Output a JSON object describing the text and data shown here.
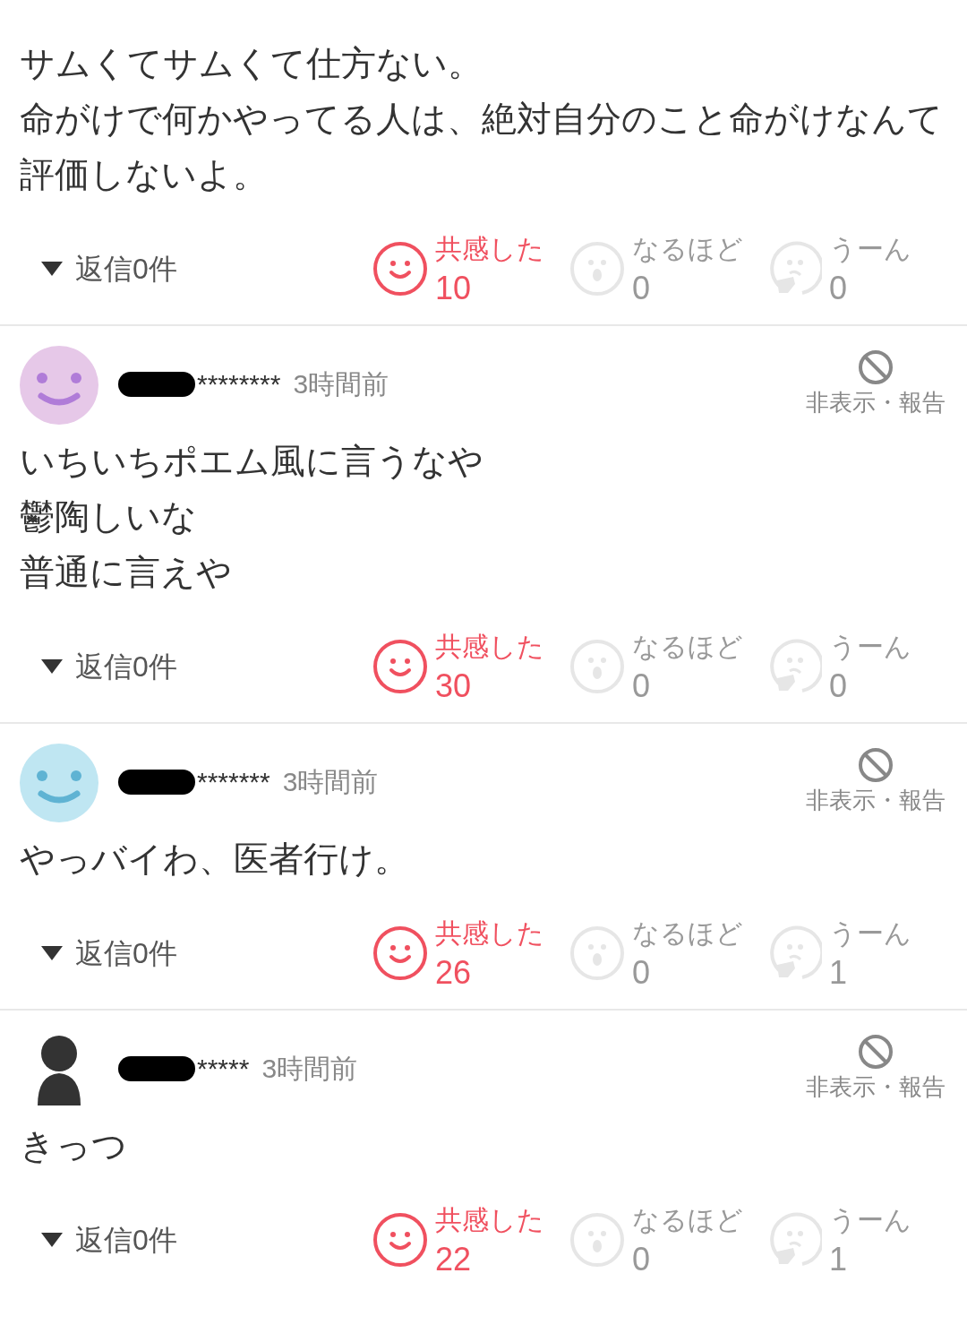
{
  "comments": [
    {
      "body": [
        "サムくてサムくて仕方ない。",
        "命がけで何かやってる人は、絶対自分のこと命がけなんて評価しないよ。"
      ],
      "replies": "返信0件",
      "reactions": [
        {
          "kind": "smile",
          "label": "共感した",
          "count": "10",
          "selected": true
        },
        {
          "kind": "surprise",
          "label": "なるほど",
          "count": "0",
          "selected": false
        },
        {
          "kind": "ponder",
          "label": "うーん",
          "count": "0",
          "selected": false
        }
      ]
    },
    {
      "avatar": {
        "kind": "smiley",
        "color": "#e6c8e8"
      },
      "user": "********",
      "time": "3時間前",
      "hide": "非表示・報告",
      "body": [
        "いちいちポエム風に言うなや",
        "鬱陶しいな",
        "普通に言えや"
      ],
      "replies": "返信0件",
      "reactions": [
        {
          "kind": "smile",
          "label": "共感した",
          "count": "30",
          "selected": true
        },
        {
          "kind": "surprise",
          "label": "なるほど",
          "count": "0",
          "selected": false
        },
        {
          "kind": "ponder",
          "label": "うーん",
          "count": "0",
          "selected": false
        }
      ]
    },
    {
      "avatar": {
        "kind": "smiley",
        "color": "#bfe6f2"
      },
      "user": "*******",
      "time": "3時間前",
      "hide": "非表示・報告",
      "body": [
        "やっバイわ、医者行け。"
      ],
      "replies": "返信0件",
      "reactions": [
        {
          "kind": "smile",
          "label": "共感した",
          "count": "26",
          "selected": true
        },
        {
          "kind": "surprise",
          "label": "なるほど",
          "count": "0",
          "selected": false
        },
        {
          "kind": "ponder",
          "label": "うーん",
          "count": "1",
          "selected": false
        }
      ]
    },
    {
      "avatar": {
        "kind": "figure"
      },
      "user": "*****",
      "time": "3時間前",
      "hide": "非表示・報告",
      "body": [
        "きっつ"
      ],
      "replies": "返信0件",
      "reactions": [
        {
          "kind": "smile",
          "label": "共感した",
          "count": "22",
          "selected": true
        },
        {
          "kind": "surprise",
          "label": "なるほど",
          "count": "0",
          "selected": false
        },
        {
          "kind": "ponder",
          "label": "うーん",
          "count": "1",
          "selected": false
        }
      ]
    }
  ]
}
